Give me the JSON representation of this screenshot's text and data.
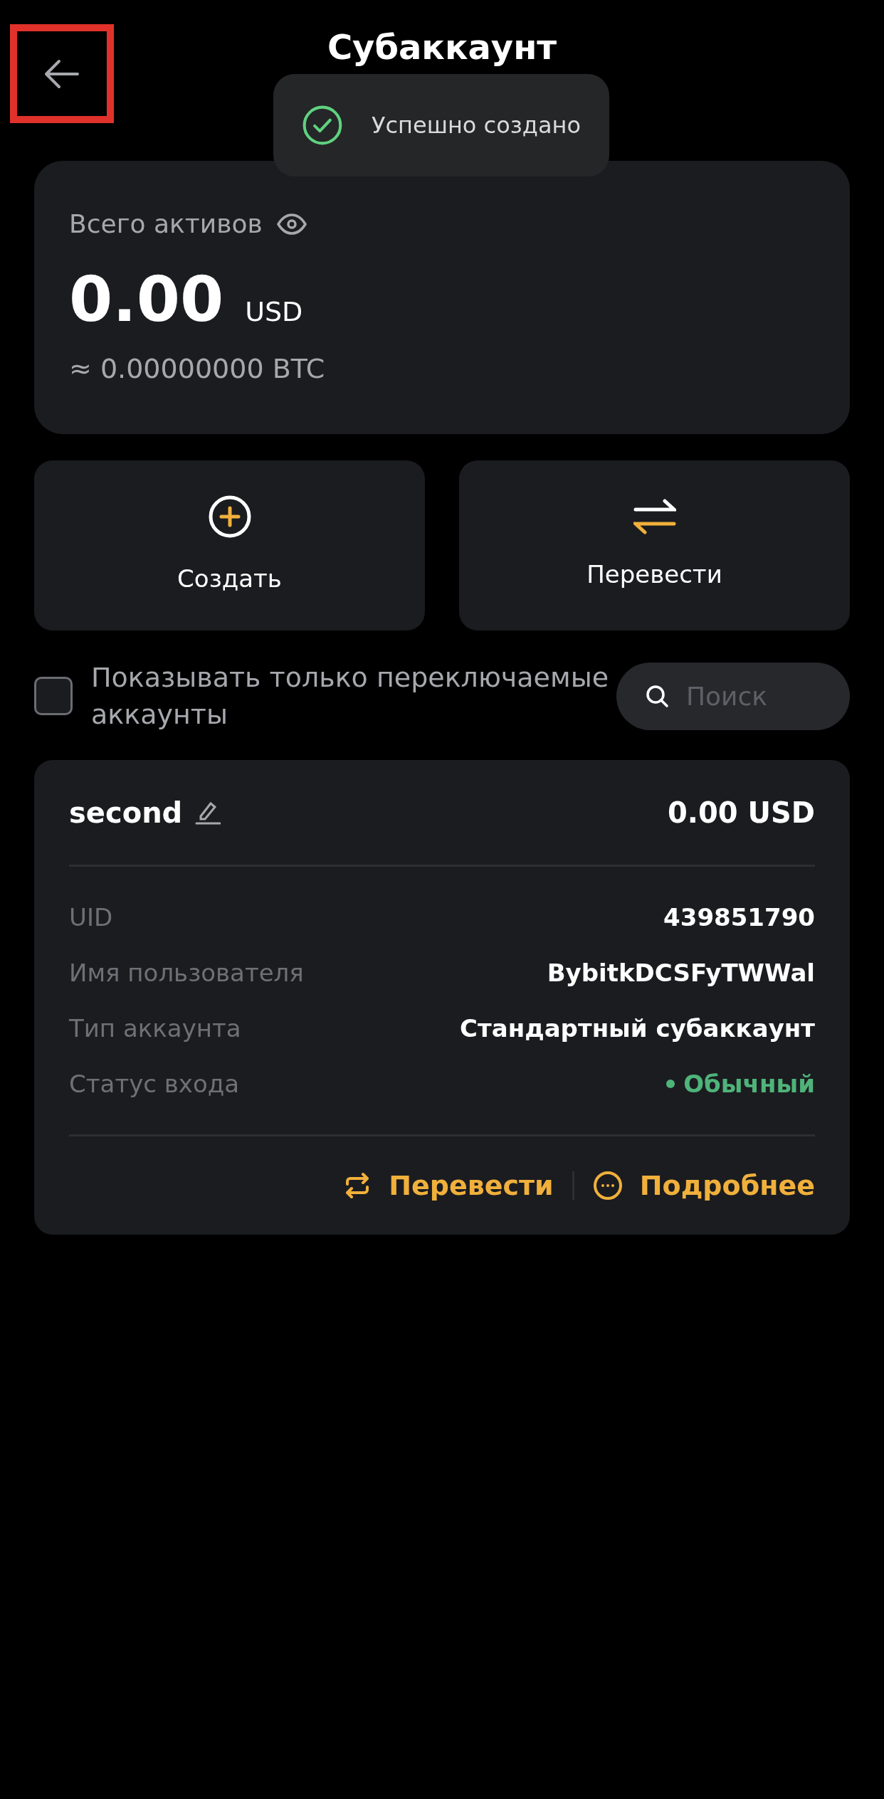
{
  "header": {
    "title": "Субаккаунт",
    "back_highlighted": true
  },
  "toast": {
    "message": "Успешно создано"
  },
  "assets": {
    "label": "Всего активов",
    "amount": "0.00",
    "currency": "USD",
    "btc": "≈ 0.00000000 BTC"
  },
  "actions": [
    {
      "kind": "create",
      "label": "Создать"
    },
    {
      "kind": "transfer",
      "label": "Перевести"
    }
  ],
  "filter": {
    "label": "Показывать только переключаемые аккаунты",
    "checked": false
  },
  "search": {
    "placeholder": "Поиск"
  },
  "accounts": [
    {
      "name": "second",
      "balance": "0.00 USD",
      "fields": [
        {
          "label": "UID",
          "value": "439851790"
        },
        {
          "label": "Имя пользователя",
          "value": "BybitkDCSFyTWWal"
        },
        {
          "label": "Тип аккаунта",
          "value": "Стандартный субаккаунт"
        },
        {
          "label": "Статус входа",
          "value": "Обычный",
          "color": "#4fb37a"
        }
      ],
      "buttons": [
        {
          "kind": "transfer",
          "label": "Перевести"
        },
        {
          "kind": "details",
          "label": "Подробнее"
        }
      ]
    }
  ]
}
